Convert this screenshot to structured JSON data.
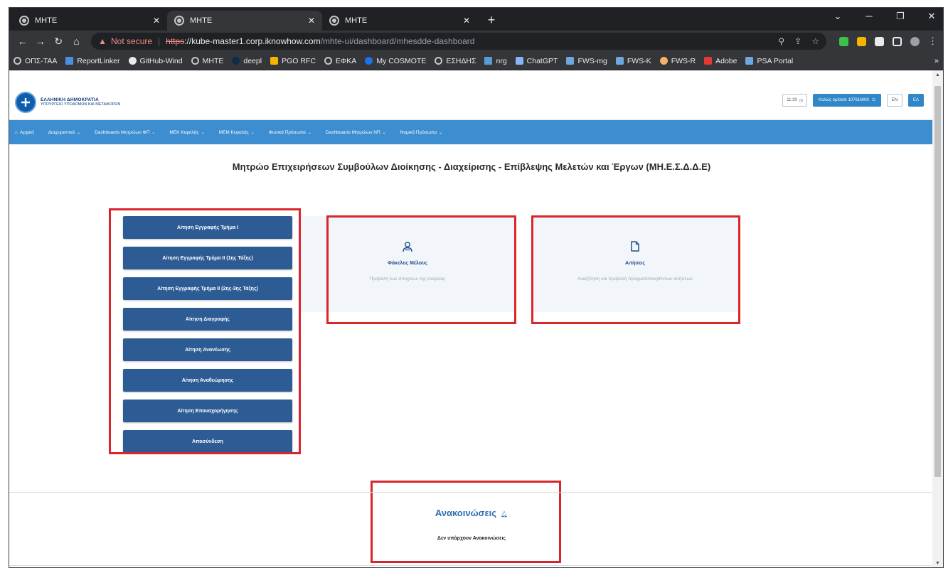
{
  "browser": {
    "tabs": [
      {
        "title": "MHTE",
        "active": false
      },
      {
        "title": "MHTE",
        "active": true
      },
      {
        "title": "MHTE",
        "active": false
      }
    ],
    "url": {
      "warning": "Not secure",
      "scheme": "https",
      "host": "://kube-master1.corp.iknowhow.com",
      "path": "/mhte-ui/dashboard/mhesdde-dashboard"
    },
    "bookmarks": [
      "ΟΠΣ-ΤΑΑ",
      "ReportLinker",
      "GitHub-Wind",
      "MHTE",
      "deepl",
      "PGO RFC",
      "ΕΦΚΑ",
      "My COSMOTE",
      "ΕΣΗΔΗΣ",
      "nrg",
      "ChatGPT",
      "FWS-mg",
      "FWS-K",
      "FWS-R",
      "Adobe",
      "PSA Portal"
    ],
    "bookmarks_more": "»"
  },
  "header": {
    "logo_line1": "ΕΛΛΗΝΙΚΗ ΔΗΜΟΚΡΑΤΙΑ",
    "logo_line2": "ΥΠΟΥΡΓΕΙΟ ΥΠΟΔΟΜΩΝ ΚΑΙ ΜΕΤΑΦΟΡΩΝ",
    "timer": "11:30",
    "welcome": "Καλώς ορίσατε 10761ΜΚΚ",
    "lang_en": "EN",
    "lang_el": "ΕΛ"
  },
  "nav": {
    "items": [
      "Αρχική",
      "Διαχειριστικά",
      "Dashboards Μητρώων ΦΠ",
      "ΜΕΚ Κεφαλής",
      "ΜΕΜ Κεφαλής",
      "Φυσικά Πρόσωπα",
      "Dashboards Μητρώων ΝΠ",
      "Νομικά Πρόσωπα"
    ]
  },
  "page": {
    "title": "Μητρώο Επιχειρήσεων Συμβούλων Διοίκησης - Διαχείρισης - Επίβλεψης Μελετών και Έργων (ΜΗ.Ε.Σ.Δ.Δ.Ε)"
  },
  "left_menu": {
    "buttons": [
      "Αίτηση Εγγραφής Τμήμα Ι",
      "Αίτηση Εγγραφής Τμήμα ΙΙ (1ης Τάξης)",
      "Αίτηση Εγγραφής Τμήμα ΙΙ (2ης-3ης Τάξης)",
      "Αίτηση Διαγραφής",
      "Αίτηση Ανανέωσης",
      "Αίτηση Αναθεώρησης",
      "Αίτηση Επαναχορήγησης",
      "Αποσύνδεση"
    ]
  },
  "cards": {
    "member": {
      "title": "Φάκελος Μέλους",
      "desc": "Προβολή των στοιχείων της εταιρείας",
      "icon": "user-icon"
    },
    "applications": {
      "title": "Αιτήσεις",
      "desc": "Αναζήτηση και προβολή πραγματοποιηθέντων αιτήσεων",
      "icon": "file-icon"
    }
  },
  "announcements": {
    "title": "Ανακοινώσεις",
    "empty": "Δεν υπάρχουν Ανακοινώσεις"
  },
  "colors": {
    "nav_bg": "#3d8ed0",
    "menu_btn": "#2d5c95",
    "highlight": "#d9252b",
    "card_bg": "#f2f6fa"
  }
}
